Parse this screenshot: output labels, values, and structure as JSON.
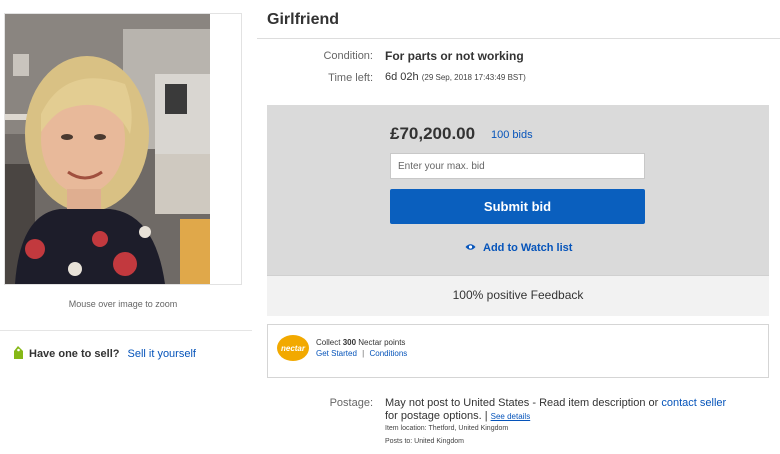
{
  "listing": {
    "title": "Girlfriend",
    "image_hint": "Mouse over image to zoom"
  },
  "sell": {
    "question": "Have one to sell?",
    "link": "Sell it yourself"
  },
  "details": {
    "condition_label": "Condition:",
    "condition_value": "For parts or not working",
    "time_label": "Time left:",
    "time_value": "6d 02h",
    "time_end": "(29 Sep, 2018   17:43:49 BST)"
  },
  "bid": {
    "price": "£70,200.00",
    "bids_count": "100 bids",
    "max_bid_placeholder": "Enter your max. bid",
    "submit_label": "Submit bid",
    "watch_label": "Add to Watch list"
  },
  "seller": {
    "feedback": "100% positive Feedback"
  },
  "nectar": {
    "logo_text": "nectar",
    "collect_prefix": "Collect",
    "points": "300",
    "collect_suffix": "Nectar points",
    "get_started": "Get Started",
    "separator": "|",
    "conditions": "Conditions"
  },
  "postage": {
    "label": "Postage:",
    "text": "May not post to United States - Read item description or",
    "contact_link": "contact seller",
    "text2": "for postage options.",
    "separator": "|",
    "see_details": "See details",
    "item_location": "Item location:  Thetford, United Kingdom",
    "posts_to": "Posts to:  United Kingdom"
  },
  "colors": {
    "link": "#0654ba",
    "submit_button": "#0a5fbe",
    "bid_panel": "#dadada",
    "nectar": "#f2a900"
  }
}
